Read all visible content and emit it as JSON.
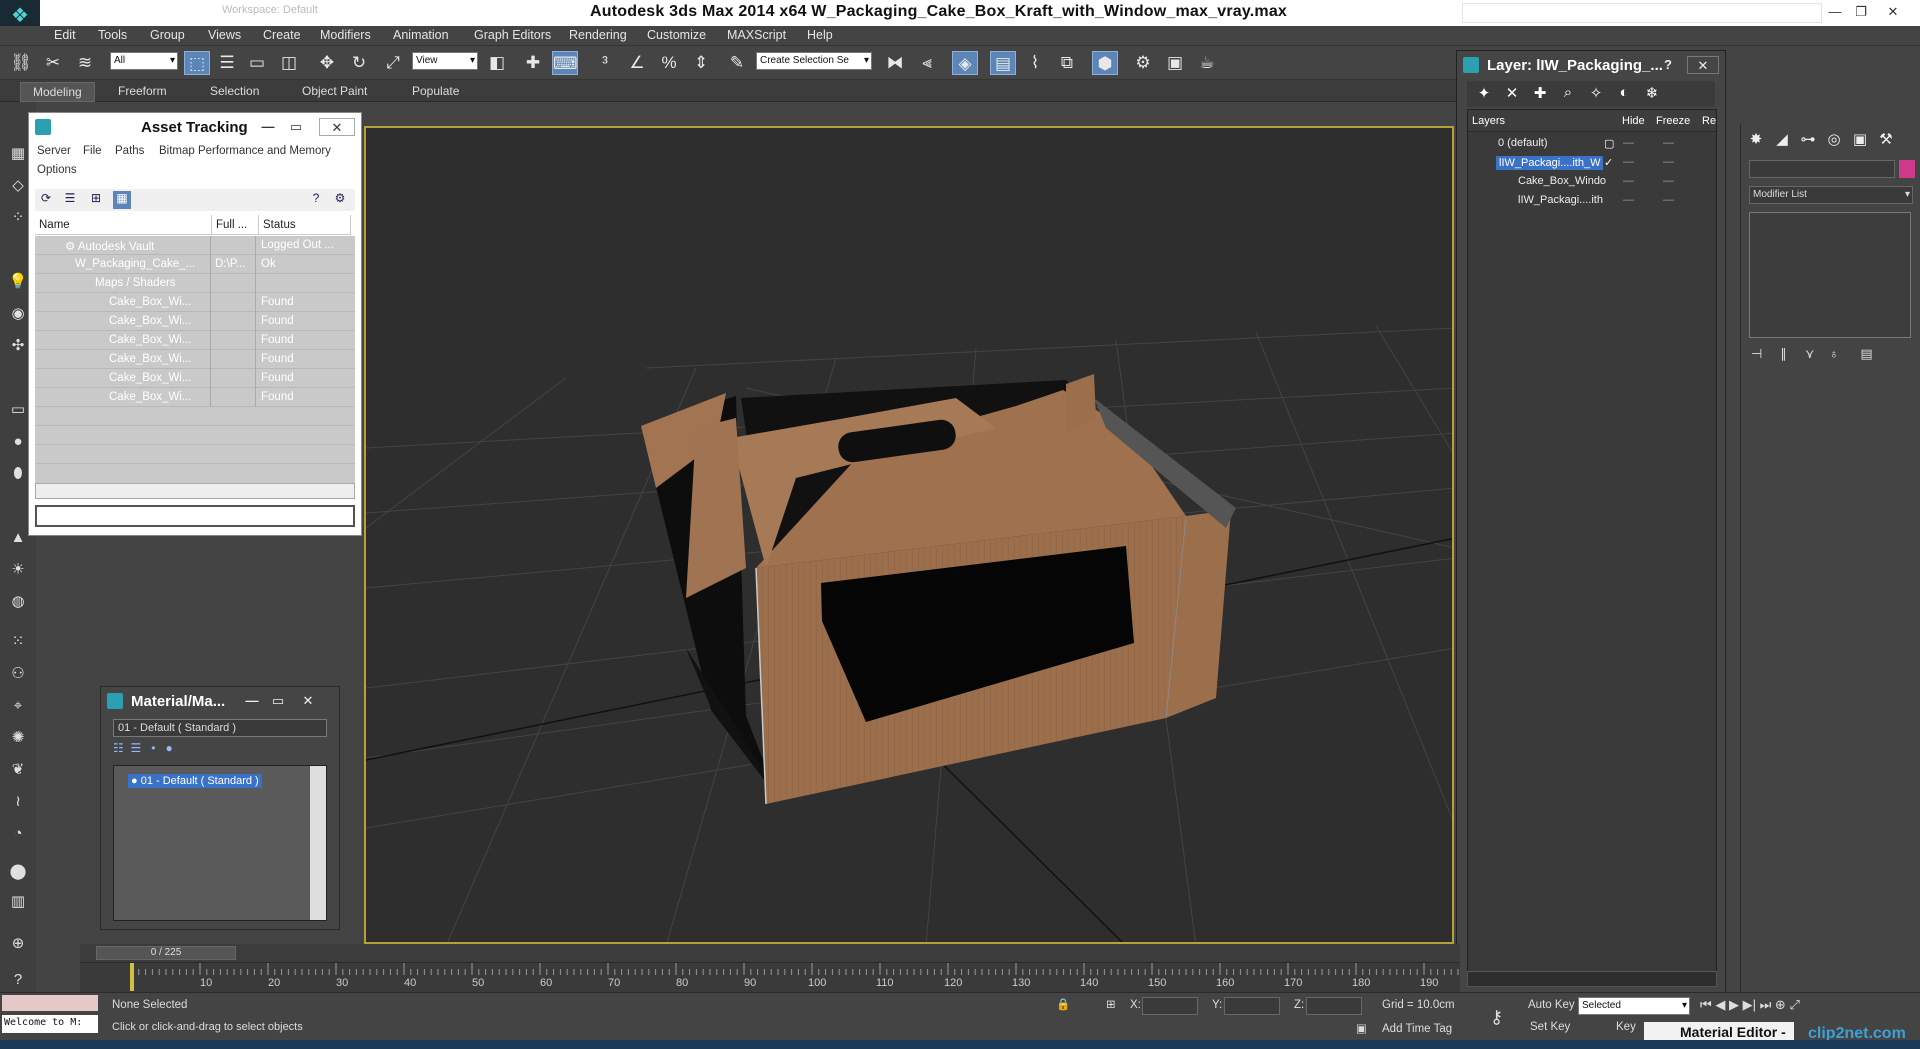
{
  "app": {
    "title": "Autodesk 3ds Max  2014 x64     W_Packaging_Cake_Box_Kraft_with_Window_max_vray.max",
    "workspace": "Workspace: Default"
  },
  "menu": [
    "Edit",
    "Tools",
    "Group",
    "Views",
    "Create",
    "Modifiers",
    "Animation",
    "Graph Editors",
    "Rendering",
    "Customize",
    "MAXScript",
    "Help"
  ],
  "toolbar": {
    "filter": "All",
    "ref_coord": "View",
    "selection_set": "Create Selection Se"
  },
  "ribbon": [
    "Modeling",
    "Freeform",
    "Selection",
    "Object Paint",
    "Populate"
  ],
  "asset_tracking": {
    "title": "Asset Tracking",
    "menu_row1": [
      "Server",
      "File",
      "Paths",
      "Bitmap Performance and Memory"
    ],
    "menu_row2": [
      "Options"
    ],
    "columns": [
      "Name",
      "Full ...",
      "Status"
    ],
    "rows": [
      {
        "name": "Autodesk Vault",
        "full": "",
        "status": "Logged Out ..."
      },
      {
        "name": "W_Packaging_Cake_...",
        "full": "D:\\P...",
        "status": "Ok"
      },
      {
        "name": "Maps / Shaders",
        "full": "",
        "status": ""
      },
      {
        "name": "Cake_Box_Wi...",
        "full": "",
        "status": "Found"
      },
      {
        "name": "Cake_Box_Wi...",
        "full": "",
        "status": "Found"
      },
      {
        "name": "Cake_Box_Wi...",
        "full": "",
        "status": "Found"
      },
      {
        "name": "Cake_Box_Wi...",
        "full": "",
        "status": "Found"
      },
      {
        "name": "Cake_Box_Wi...",
        "full": "",
        "status": "Found"
      },
      {
        "name": "Cake_Box_Wi...",
        "full": "",
        "status": "Found"
      }
    ]
  },
  "layer_panel": {
    "title": "Layer: lIW_Packaging_...",
    "columns": [
      "Layers",
      "Hide",
      "Freeze",
      "Re"
    ],
    "rows": [
      {
        "name": "0 (default)",
        "selected": false
      },
      {
        "name": "lIW_Packagi....ith_W",
        "selected": true
      },
      {
        "name": "Cake_Box_Windo",
        "selected": false
      },
      {
        "name": "lIW_Packagi....ith",
        "selected": false
      }
    ]
  },
  "material": {
    "title": "Material/Ma...",
    "name": "01 - Default  ( Standard )",
    "selected": "01 - Default  ( Standard )"
  },
  "command_panel": {
    "modifier_list": "Modifier List"
  },
  "timeline": {
    "frame": "0 / 225",
    "ticks": [
      "10",
      "20",
      "30",
      "40",
      "50",
      "60",
      "70",
      "80",
      "90",
      "100",
      "110",
      "120",
      "130",
      "140",
      "150",
      "160",
      "170",
      "180",
      "190"
    ]
  },
  "status": {
    "selection": "None Selected",
    "prompt": "Click or click-and-drag to select objects",
    "maxscript": "Welcome to M:",
    "x_label": "X:",
    "y_label": "Y:",
    "z_label": "Z:",
    "grid": "Grid = 10.0cm",
    "add_time_tag": "Add Time Tag",
    "auto_key": "Auto Key",
    "set_key": "Set Key",
    "key_filter": "Selected",
    "key_short": "Key"
  },
  "taskbar": {
    "active": "Material Editor -",
    "watermark": "clip2net.com"
  }
}
